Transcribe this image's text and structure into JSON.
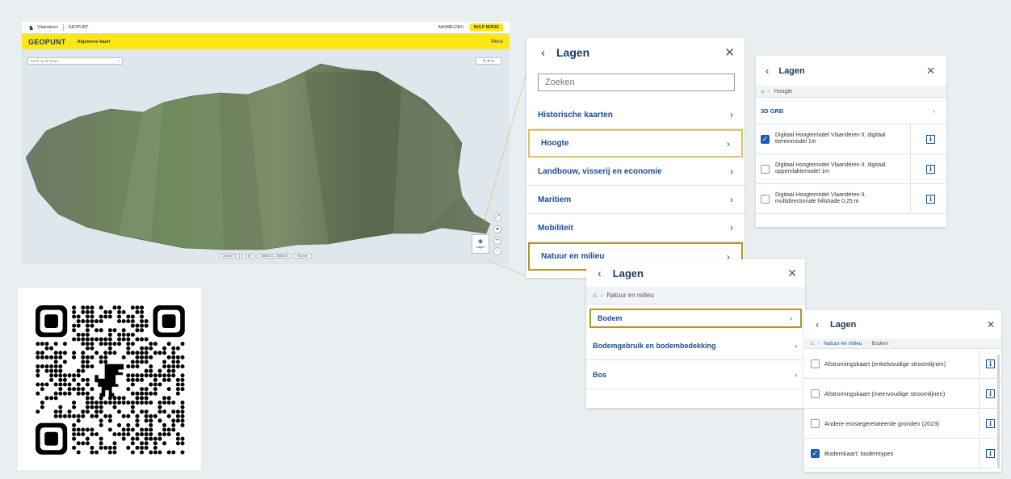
{
  "app": {
    "region_label": "Vlaanderen",
    "product_label": "GEOPUNT",
    "top_right_label": "AANMELDEN",
    "help_label": "HULP NODIG",
    "brand": "GEOPUNT",
    "crumb": "Algemene kaart",
    "menu_label": "Menu",
    "search_placeholder": "Zoek op de kaart",
    "lagen_button": "Lagen",
    "scale_items": [
      "Lambert 72",
      "0 km",
      "208660.31, 208660.91",
      "Bronnen"
    ]
  },
  "panel1": {
    "title": "Lagen",
    "search_placeholder": "Zoeken",
    "items": [
      {
        "label": "Historische kaarten"
      },
      {
        "label": "Hoogte"
      },
      {
        "label": "Landbouw, visserij en economie"
      },
      {
        "label": "Maritiem"
      },
      {
        "label": "Mobiliteit"
      },
      {
        "label": "Natuur en milieu"
      }
    ]
  },
  "panel2": {
    "title": "Lagen",
    "crumbs": [
      "Hoogte"
    ],
    "row": "3D GRB",
    "layers": [
      {
        "label": "Digitaal Hoogtemodel Vlaanderen II, digitaal terreinmodel 1m",
        "checked": true
      },
      {
        "label": "Digitaal Hoogtemodel Vlaanderen II, digitaal oppervlaktemodel 1m",
        "checked": false
      },
      {
        "label": "Digitaal Hoogtemodel Vlaanderen II, multidirectionale hillshade 0,25 m",
        "checked": false
      }
    ]
  },
  "panel3": {
    "title": "Lagen",
    "crumbs": [
      "Natuur en milieu"
    ],
    "items": [
      {
        "label": "Bodem"
      },
      {
        "label": "Bodemgebruik en bodembedekking"
      },
      {
        "label": "Bos"
      }
    ]
  },
  "panel4": {
    "title": "Lagen",
    "crumbs": [
      "Natuur en milieu",
      "Bodem"
    ],
    "layers": [
      {
        "label": "Afstromingskaart (enkelvoudige stroomlijnen)",
        "checked": false
      },
      {
        "label": "Afstromingskaart (meervoudige stroomlijnen)",
        "checked": false
      },
      {
        "label": "Andere erosiegerelateerde gronden (2023)",
        "checked": false
      },
      {
        "label": "Bodemkaart: bodemtypes",
        "checked": true
      }
    ]
  },
  "colors": {
    "accent_yellow": "#ffe615",
    "link_blue": "#1c4b94",
    "highlight_border": "#b4952a",
    "checkbox_blue": "#1e5ab8"
  },
  "icons": [
    "back-chevron-icon",
    "close-icon",
    "home-icon",
    "chevron-right-icon",
    "info-icon",
    "check-icon",
    "layers-icon"
  ]
}
